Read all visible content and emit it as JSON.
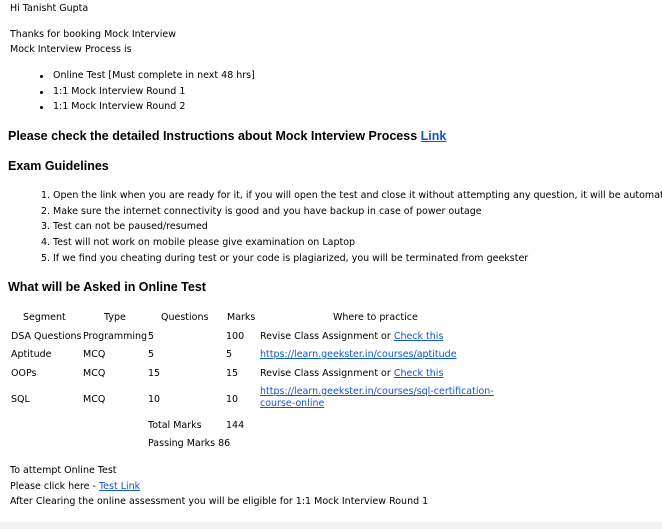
{
  "greeting": "Hi Tanisht Gupta",
  "intro": {
    "thanks": "Thanks for booking Mock Interview",
    "process_label": "Mock Interview Process is"
  },
  "process_steps": [
    "Online Test [Must complete in next 48 hrs]",
    "1:1 Mock Interview Round 1",
    "1:1 Mock Interview Round 2"
  ],
  "instructions": {
    "text": "Please check the detailed Instructions about Mock Interview Process",
    "link_label": "Link"
  },
  "guidelines": {
    "title": "Exam Guidelines",
    "items": [
      "Open the link when you are ready for it, if you will open the test and close it without attempting any question, it will be automatica",
      "Make sure the internet connectivity is good and you have backup in case of power outage",
      "Test can not be paused/resumed",
      "Test will not work on mobile please give examination on Laptop",
      "If we find you cheating during test or your code is plagiarized, you will be terminated from geekster"
    ]
  },
  "online_test": {
    "title": "What will be Asked in Online Test",
    "headers": {
      "segment": "Segment",
      "type": "Type",
      "questions": "Questions",
      "marks": "Marks",
      "practice": "Where to practice"
    },
    "rows": [
      {
        "segment": "DSA Questions",
        "type": "Programming",
        "questions": "5",
        "marks": "100",
        "practice_text": "Revise Class Assignment or ",
        "practice_link": "Check this"
      },
      {
        "segment": "Aptitude",
        "type": "MCQ",
        "questions": "5",
        "marks": "5",
        "practice_text": "",
        "practice_link": "https://learn.geekster.in/courses/aptitude"
      },
      {
        "segment": "OOPs",
        "type": "MCQ",
        "questions": "15",
        "marks": "15",
        "practice_text": "Revise Class Assignment or ",
        "practice_link": "Check this"
      },
      {
        "segment": "SQL",
        "type": "MCQ",
        "questions": "10",
        "marks": "10",
        "practice_text": "",
        "practice_link_line1": "https://learn.geekster.in/courses/sql-certification-",
        "practice_link_line2": "course-online"
      }
    ],
    "total_label": "Total Marks",
    "total_value": "144",
    "passing_label": "Passing Marks",
    "passing_value": "86"
  },
  "footer": {
    "attempt": "To attempt Online Test",
    "click_prefix": "Please click here - ",
    "test_link": "Test Link",
    "after": "After Clearing the online assessment you will be eligible for 1:1 Mock Interview Round 1"
  },
  "colors": {
    "link": "#1155cc",
    "text": "#000000",
    "background": "#ffffff"
  }
}
